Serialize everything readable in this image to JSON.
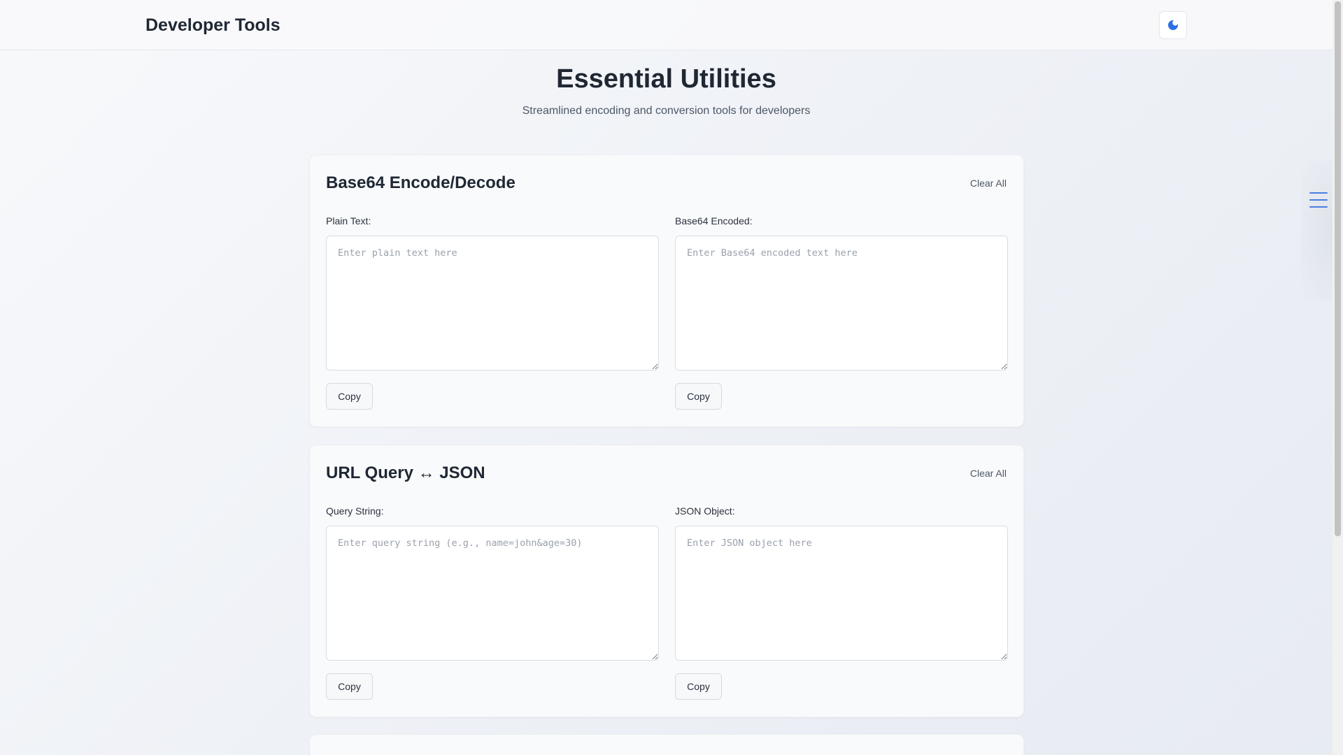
{
  "header": {
    "brand": "Developer Tools",
    "theme_icon": "theme-toggle-icon"
  },
  "hero": {
    "title": "Essential Utilities",
    "subtitle": "Streamlined encoding and conversion tools for developers"
  },
  "tools": [
    {
      "title": "Base64 Encode/Decode",
      "clear_label": "Clear All",
      "left": {
        "label": "Plain Text:",
        "placeholder": "Enter plain text here",
        "value": "",
        "copy_label": "Copy"
      },
      "right": {
        "label": "Base64 Encoded:",
        "placeholder": "Enter Base64 encoded text here",
        "value": "",
        "copy_label": "Copy"
      }
    },
    {
      "title": "URL Query ↔ JSON",
      "clear_label": "Clear All",
      "left": {
        "label": "Query String:",
        "placeholder": "Enter query string (e.g., name=john&age=30)",
        "value": "",
        "copy_label": "Copy"
      },
      "right": {
        "label": "JSON Object:",
        "placeholder": "Enter JSON object here",
        "value": "",
        "copy_label": "Copy"
      }
    }
  ],
  "side_menu": {
    "icon": "hamburger-menu-icon"
  },
  "colors": {
    "accent": "#4a7de0",
    "text": "#1f2733",
    "muted": "#4d5766",
    "card_bg": "#f9fafb"
  }
}
